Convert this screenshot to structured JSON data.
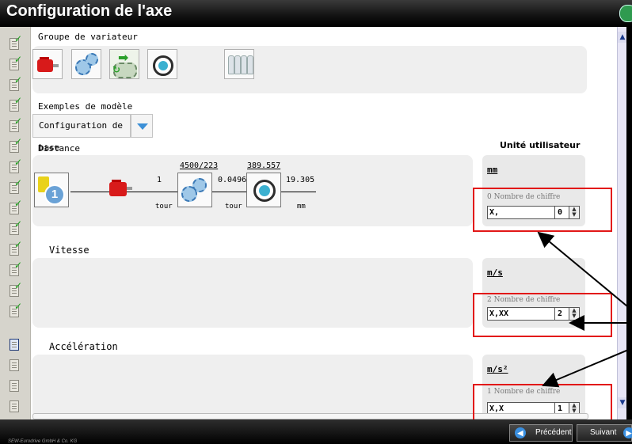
{
  "window": {
    "title": "Configuration de l'axe"
  },
  "sections": {
    "groupe": "Groupe de variateur",
    "exemples": "Exemples de modèle",
    "distance": "Distance",
    "vitesse": "Vitesse",
    "acceleration": "Accélération"
  },
  "variator_icons": [
    "motor-icon",
    "gear-unit-icon",
    "screw-conveyor-icon",
    "drum-drive-icon",
    "bottle-line-icon"
  ],
  "model_example": {
    "selected": "Configuration de base"
  },
  "chain": {
    "encoder_number": "1",
    "ratio_1": "1",
    "ratio_1_unit": "tour",
    "ratio_2_top": "4500/223",
    "ratio_2": "0.0496",
    "ratio_2_unit": "tour",
    "ratio_3_top": "389.557",
    "ratio_3": "19.305",
    "ratio_3_unit": "mm"
  },
  "user_unit": {
    "title": "Unité utilisateur",
    "distance": {
      "unit": "mm",
      "digits_label": "0 Nombre de chiffre",
      "format": "X,",
      "digits": "0"
    },
    "vitesse": {
      "unit": "m/s",
      "digits_label": "2 Nombre de chiffre",
      "format": "X,XX",
      "digits": "2"
    },
    "acceleration": {
      "unit": "m/s²",
      "digits_label": "1 Nombre de chiffre",
      "format": "X,X",
      "digits": "1"
    }
  },
  "footer": {
    "company": "SEW-Eurodrive GmbH & Co. KG",
    "prev": "Précédent",
    "next": "Suivant"
  },
  "colors": {
    "highlight": "#e21818",
    "accent": "#3b8fd6",
    "check": "#1aa01a"
  }
}
